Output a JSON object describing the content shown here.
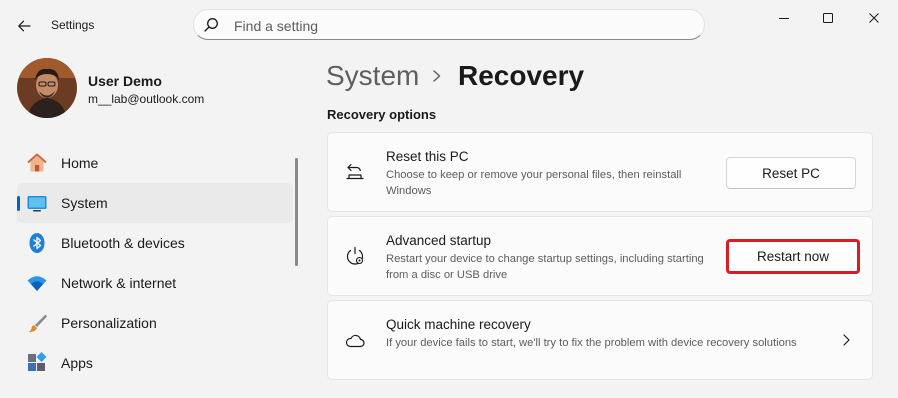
{
  "app": {
    "title": "Settings"
  },
  "search": {
    "placeholder": "Find a setting"
  },
  "user": {
    "name": "User Demo",
    "email": "m__lab@outlook.com"
  },
  "nav": [
    {
      "label": "Home",
      "icon": "home-icon",
      "active": false
    },
    {
      "label": "System",
      "icon": "system-icon",
      "active": true
    },
    {
      "label": "Bluetooth & devices",
      "icon": "bluetooth-icon",
      "active": false
    },
    {
      "label": "Network & internet",
      "icon": "wifi-icon",
      "active": false
    },
    {
      "label": "Personalization",
      "icon": "brush-icon",
      "active": false
    },
    {
      "label": "Apps",
      "icon": "apps-icon",
      "active": false
    }
  ],
  "breadcrumb": {
    "parent": "System",
    "current": "Recovery"
  },
  "section": {
    "title": "Recovery options"
  },
  "cards": [
    {
      "title": "Reset this PC",
      "description": "Choose to keep or remove your personal files, then reinstall Windows",
      "icon": "reset-pc-icon",
      "button": "Reset PC"
    },
    {
      "title": "Advanced startup",
      "description": "Restart your device to change startup settings, including starting from a disc or USB drive",
      "icon": "advanced-startup-icon",
      "button": "Restart now"
    },
    {
      "title": "Quick machine recovery",
      "description": "If your device fails to start, we'll try to fix the problem with device recovery solutions",
      "icon": "cloud-icon"
    }
  ],
  "colors": {
    "accent": "#0067c0",
    "highlight_border": "#d71e25",
    "background": "#f3f3f3",
    "card": "#fbfbfb"
  }
}
